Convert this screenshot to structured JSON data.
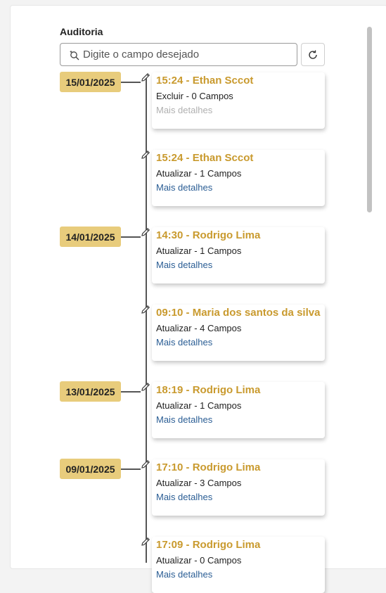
{
  "title": "Auditoria",
  "search": {
    "placeholder": "Digite o campo desejado"
  },
  "dates": [
    "15/01/2025",
    "14/01/2025",
    "13/01/2025",
    "09/01/2025"
  ],
  "entries": [
    {
      "head": "15:24 - Ethan Sccot",
      "action": "Excluir - 0 Campos",
      "more": "Mais detalhes"
    },
    {
      "head": "15:24 - Ethan Sccot",
      "action": "Atualizar - 1 Campos",
      "more": "Mais detalhes"
    },
    {
      "head": "14:30 - Rodrigo Lima",
      "action": "Atualizar - 1 Campos",
      "more": "Mais detalhes"
    },
    {
      "head": "09:10 - Maria dos santos da silva",
      "action": "Atualizar - 4 Campos",
      "more": "Mais detalhes"
    },
    {
      "head": "18:19 - Rodrigo Lima",
      "action": "Atualizar - 1 Campos",
      "more": "Mais detalhes"
    },
    {
      "head": "17:10 - Rodrigo Lima",
      "action": "Atualizar - 3 Campos",
      "more": "Mais detalhes"
    },
    {
      "head": "17:09 - Rodrigo Lima",
      "action": "Atualizar - 0 Campos",
      "more": "Mais detalhes"
    }
  ],
  "icons": {
    "search": "sparkle-search-icon",
    "refresh": "refresh-icon",
    "edit": "pencil-icon"
  },
  "colors": {
    "date_badge": "#e8cc7c",
    "entry_title": "#c99a2e",
    "link": "#2a5d94",
    "link_disabled": "#b0b0b0"
  }
}
